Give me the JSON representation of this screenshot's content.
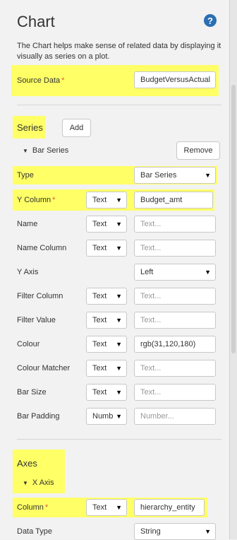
{
  "header": {
    "title": "Chart",
    "help_icon_glyph": "?",
    "description": "The Chart helps make sense of related data by displaying it visually as series on a plot."
  },
  "source_data": {
    "label": "Source Data",
    "required_mark": "*",
    "value": "BudgetVersusActual"
  },
  "series": {
    "title": "Series",
    "add_label": "Add",
    "group_label": "Bar Series",
    "remove_label": "Remove",
    "fields": [
      {
        "label": "Type",
        "select": "Bar Series"
      },
      {
        "label": "Y Column",
        "required": "*",
        "mode": "Text",
        "value": "Budget_amt"
      },
      {
        "label": "Name",
        "mode": "Text",
        "placeholder": "Text..."
      },
      {
        "label": "Name Column",
        "mode": "Text",
        "placeholder": "Text..."
      },
      {
        "label": "Y Axis",
        "select": "Left"
      },
      {
        "label": "Filter Column",
        "mode": "Text",
        "placeholder": "Text..."
      },
      {
        "label": "Filter Value",
        "mode": "Text",
        "placeholder": "Text..."
      },
      {
        "label": "Colour",
        "mode": "Text",
        "value": "rgb(31,120,180)"
      },
      {
        "label": "Colour Matcher",
        "mode": "Text",
        "placeholder": "Text..."
      },
      {
        "label": "Bar Size",
        "mode": "Text",
        "placeholder": "Text..."
      },
      {
        "label": "Bar Padding",
        "mode": "Numb",
        "placeholder": "Number..."
      }
    ]
  },
  "axes": {
    "title": "Axes",
    "group_label": "X Axis",
    "fields": [
      {
        "label": "Column",
        "required": "*",
        "mode": "Text",
        "value": "hierarchy_entity"
      },
      {
        "label": "Data Type",
        "select": "String"
      }
    ]
  },
  "icons": {
    "dropdown_arrow": "▼",
    "expand_triangle": "▼"
  },
  "colors": {
    "highlight": "#ffff66",
    "required": "#d9534f",
    "help_icon": "#2a6fb3"
  }
}
